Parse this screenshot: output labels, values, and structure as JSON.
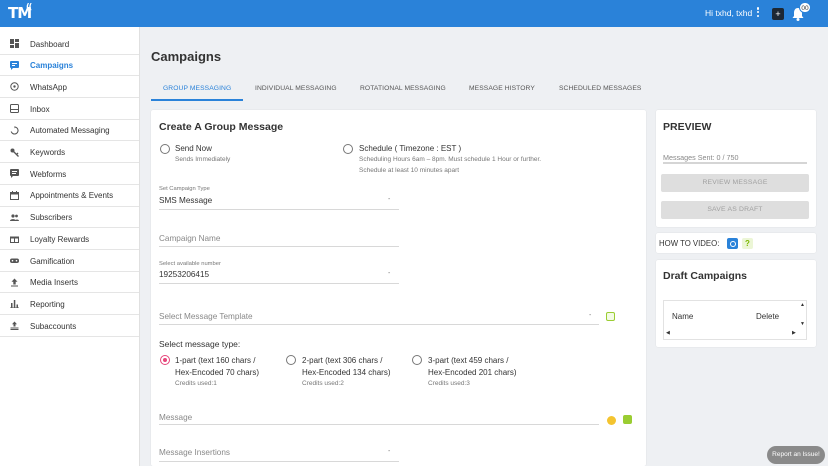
{
  "colors": {
    "primary": "#2a82d9",
    "accent_radio": "#e6457a",
    "green_icon": "#9acd32"
  },
  "topbar": {
    "logo": "TM",
    "greeting": "Hi txhd, txhd",
    "notification_count": "00",
    "dark_button_symbol": "+"
  },
  "sidebar": {
    "items": [
      {
        "label": "Dashboard",
        "icon": "dashboard-icon"
      },
      {
        "label": "Campaigns",
        "icon": "campaign-icon",
        "active": true
      },
      {
        "label": "WhatsApp",
        "icon": "whatsapp-icon"
      },
      {
        "label": "Inbox",
        "icon": "inbox-icon"
      },
      {
        "label": "Automated Messaging",
        "icon": "autorenew-icon"
      },
      {
        "label": "Keywords",
        "icon": "key-icon"
      },
      {
        "label": "Webforms",
        "icon": "webform-icon"
      },
      {
        "label": "Appointments & Events",
        "icon": "calendar-icon"
      },
      {
        "label": "Subscribers",
        "icon": "people-icon"
      },
      {
        "label": "Loyalty Rewards",
        "icon": "gift-icon"
      },
      {
        "label": "Gamification",
        "icon": "gamepad-icon"
      },
      {
        "label": "Media Inserts",
        "icon": "upload-icon"
      },
      {
        "label": "Reporting",
        "icon": "bar-chart-icon"
      },
      {
        "label": "Subaccounts",
        "icon": "subaccount-icon"
      }
    ]
  },
  "main": {
    "title": "Campaigns",
    "tabs": [
      {
        "label": "GROUP MESSAGING",
        "active": true
      },
      {
        "label": "INDIVIDUAL MESSAGING"
      },
      {
        "label": "ROTATIONAL MESSAGING"
      },
      {
        "label": "MESSAGE HISTORY"
      },
      {
        "label": "SCHEDULED MESSAGES"
      }
    ]
  },
  "form": {
    "heading": "Create A Group Message",
    "send_now": {
      "label": "Send Now",
      "sub": "Sends Immediately"
    },
    "schedule": {
      "label": "Schedule ( Timezone : EST )",
      "sub1": "Scheduling Hours 6am – 8pm. Must schedule 1 Hour or further.",
      "sub2": "Schedule at least 10 minutes apart"
    },
    "campaign_type": {
      "label": "Set Campaign Type",
      "value": "SMS Message"
    },
    "campaign_name": {
      "placeholder": "Campaign Name"
    },
    "number": {
      "label": "Select available number",
      "value": "19253206415"
    },
    "template": {
      "placeholder": "Select Message Template"
    },
    "message_type": {
      "heading": "Select message type:",
      "options": [
        {
          "line1": "1-part (text 160 chars /",
          "line2": "Hex-Encoded 70 chars)",
          "credits": "Credits used:1",
          "checked": true
        },
        {
          "line1": "2-part (text 306 chars /",
          "line2": "Hex-Encoded 134 chars)",
          "credits": "Credits used:2"
        },
        {
          "line1": "3-part (text 459 chars /",
          "line2": "Hex-Encoded 201 chars)",
          "credits": "Credits used:3"
        }
      ]
    },
    "message": {
      "placeholder": "Message"
    },
    "insertions": {
      "placeholder": "Message Insertions"
    }
  },
  "preview": {
    "title": "PREVIEW",
    "messages_sent": "Messages Sent: 0 / 750",
    "progress": 0,
    "review_btn": "REVIEW MESSAGE",
    "draft_btn": "SAVE AS DRAFT"
  },
  "howto": {
    "label": "HOW TO VIDEO:",
    "help_symbol": "?"
  },
  "drafts": {
    "title": "Draft Campaigns",
    "columns": [
      "Name",
      "Delete"
    ]
  },
  "report_issue": "Report an Issue!"
}
